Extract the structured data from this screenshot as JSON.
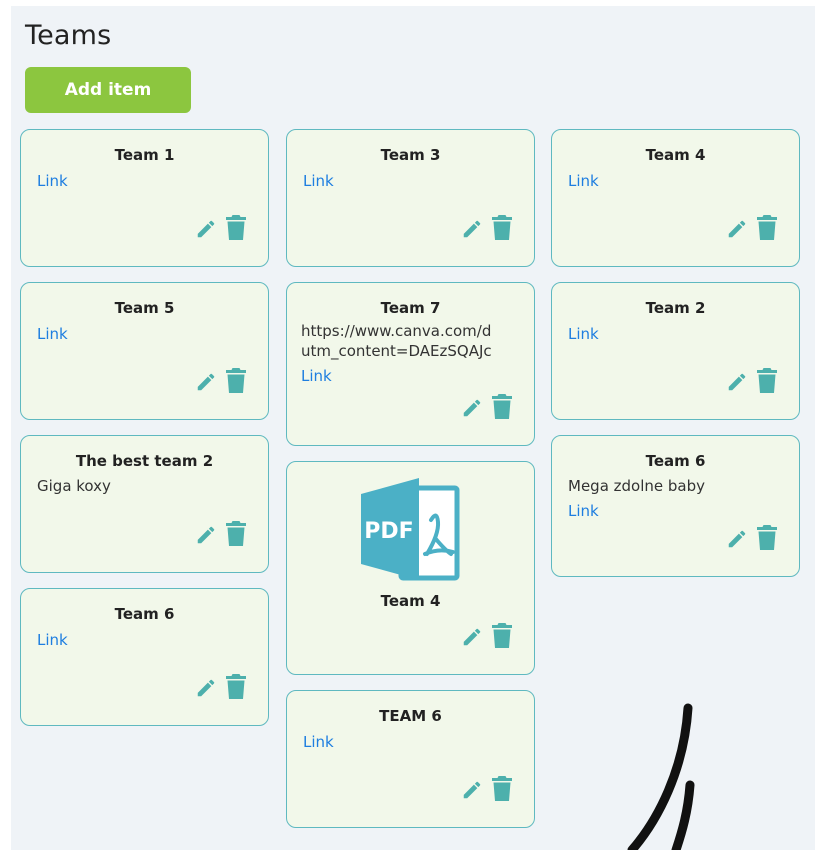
{
  "page": {
    "title": "Teams",
    "add_button": "Add item"
  },
  "columns": [
    [
      {
        "title": "Team 1",
        "link": "Link"
      },
      {
        "title": "Team 5",
        "link": "Link"
      },
      {
        "title": "The best team 2",
        "text": "Giga koxy"
      },
      {
        "title": "Team 6",
        "link": "Link"
      }
    ],
    [
      {
        "title": "Team 3",
        "link": "Link"
      },
      {
        "title": "Team 7",
        "text_lines": [
          "https://www.canva.com/d",
          "utm_content=DAEzSQAJc"
        ],
        "link": "Link"
      },
      {
        "title": "Team 4",
        "file": "PDF"
      },
      {
        "title": "TEAM 6",
        "link": "Link"
      }
    ],
    [
      {
        "title": "Team 4",
        "link": "Link"
      },
      {
        "title": "Team 2",
        "link": "Link"
      },
      {
        "title": "Team 6",
        "text": "Mega zdolne baby",
        "link": "Link"
      }
    ]
  ],
  "colors": {
    "accent_green": "#8cc63f",
    "card_border": "#5fb9c0",
    "icon_teal": "#4db0ac",
    "link_blue": "#1e7ee0",
    "pdf_blue": "#4bb0c6"
  },
  "icons": {
    "edit": "pencil-icon",
    "delete": "trash-icon",
    "file": "pdf-file-icon"
  }
}
